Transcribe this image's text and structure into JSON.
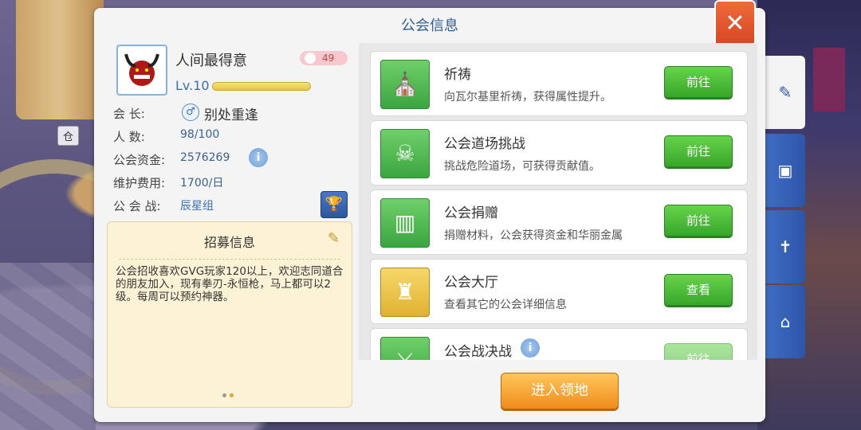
{
  "panel": {
    "title": "公会信息"
  },
  "guild": {
    "name": "人间最得意",
    "badge_value": "49",
    "level": "Lv.10",
    "leader_label": "会    长:",
    "leader_value": "别处重逢",
    "members_label": "人    数:",
    "members_value": "98/100",
    "funds_label": "公会资金:",
    "funds_value": "2576269",
    "upkeep_label": "维护费用:",
    "upkeep_value": "1700/日",
    "war_label": "公 会 战:",
    "war_value": "辰星组"
  },
  "recruit": {
    "title": "招募信息",
    "text": "公会招收喜欢GVG玩家120以上，欢迎志同道合的朋友加入，现有拳刃-永恒枪，马上都可以2级。每周可以预约神器。"
  },
  "activities": [
    {
      "name": "祈祷",
      "desc": "向瓦尔基里祈祷，获得属性提升。",
      "button": "前往",
      "icon": "hood-icon"
    },
    {
      "name": "公会道场挑战",
      "desc": "挑战危险道场，可获得贡献值。",
      "button": "前往",
      "icon": "skull-icon"
    },
    {
      "name": "公会捐赠",
      "desc": "捐赠材料，公会获得资金和华丽金属",
      "button": "前往",
      "icon": "donation-icon"
    },
    {
      "name": "公会大厅",
      "desc": "查看其它的公会详细信息",
      "button": "查看",
      "icon": "castle-icon"
    },
    {
      "name": "公会战决战",
      "desc": "",
      "button": "前往",
      "icon": "crossed-swords-icon"
    }
  ],
  "enter_button": "进入领地",
  "bg_tags": {
    "left_tag": "仓"
  },
  "colors": {
    "accent": "#2f5d9a",
    "go_green": "#38a62a",
    "enter_orange": "#f08c1c",
    "close_red": "#d2401f"
  }
}
